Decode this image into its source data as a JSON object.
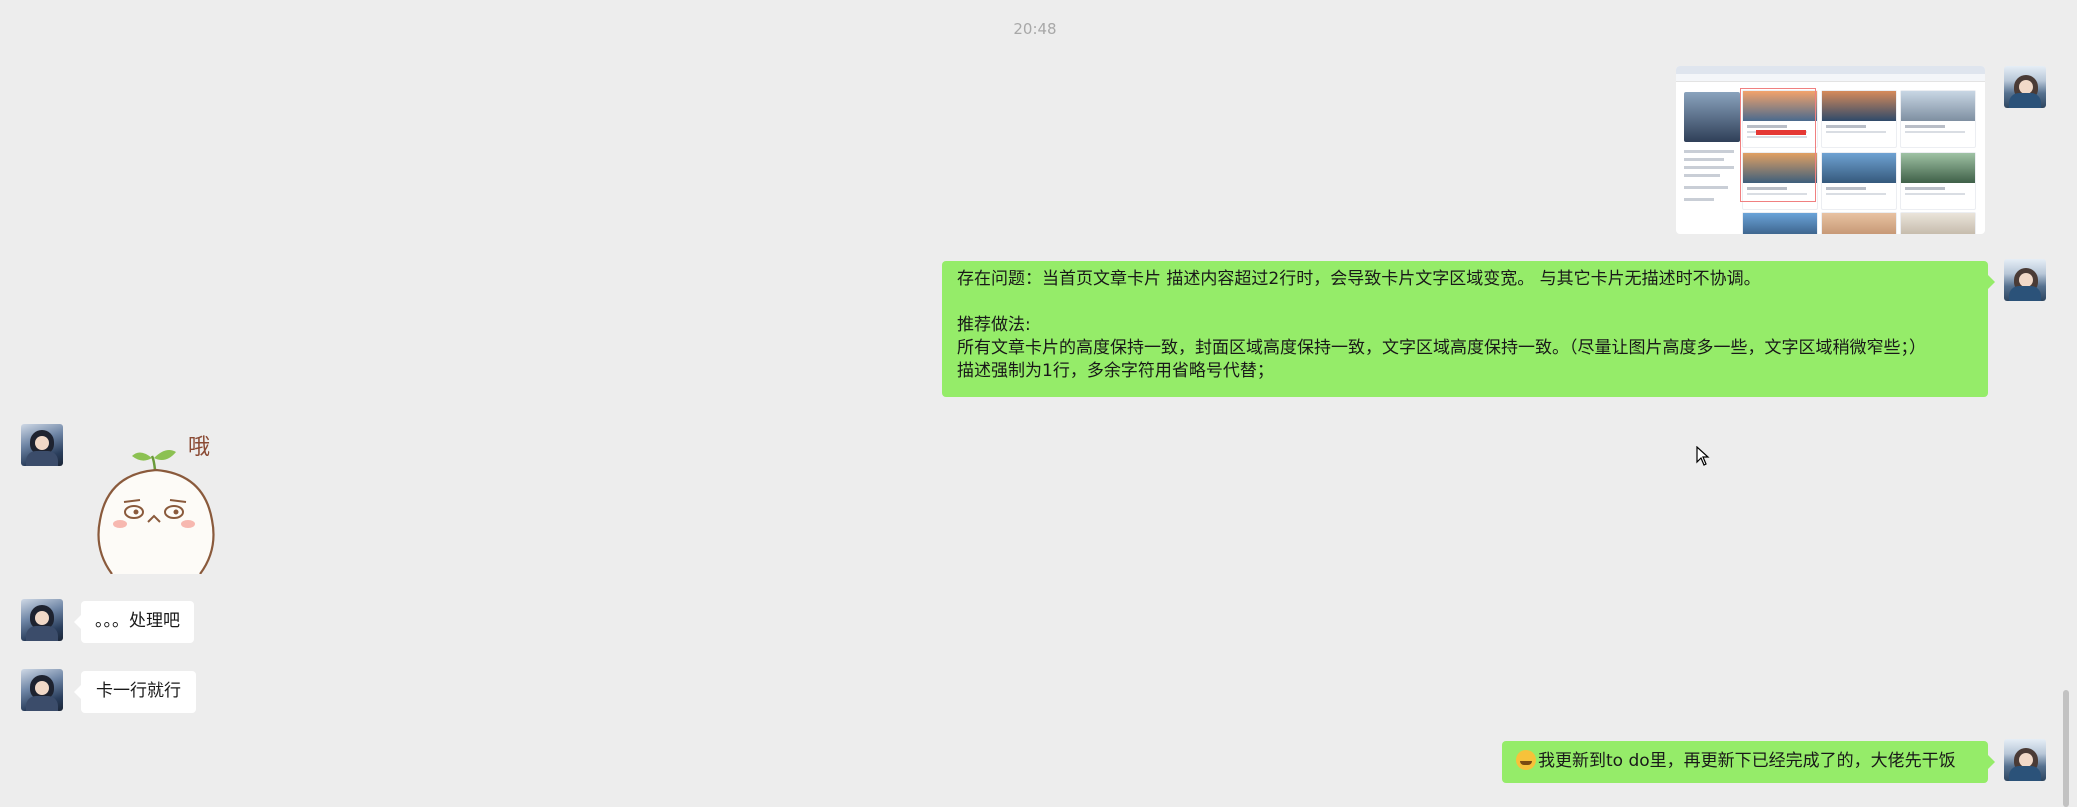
{
  "timestamp": "20:48",
  "messages": {
    "m2": {
      "lines": [
        "存在问题：当首页文章卡片 描述内容超过2行时，会导致卡片文字区域变宽。 与其它卡片无描述时不协调。",
        "",
        "推荐做法:",
        "所有文章卡片的高度保持一致，封面区域高度保持一致，文字区域高度保持一致。（尽量让图片高度多一些，文字区域稍微窄些；）",
        "描述强制为1行，多余字符用省略号代替；"
      ]
    },
    "m3": {
      "sticker_text": "哦"
    },
    "m4": {
      "text": "。。。处理吧"
    },
    "m5": {
      "text": "卡一行就行"
    },
    "m6": {
      "emoji": "face-with-tears-emoji",
      "text": "我更新到to do里，再更新下已经完成了的，大佬先干饭"
    }
  },
  "thumbnail": {
    "overlay_text": "文字区域太宽了",
    "card_colors": [
      "#2f3f58",
      "#e8835a",
      "#c9785b",
      "#9bb0c6",
      "#d48b4a",
      "#5a86b5",
      "#4f6f52",
      "#6b9ccf",
      "#e2b08a",
      "#ddd6cc"
    ]
  }
}
